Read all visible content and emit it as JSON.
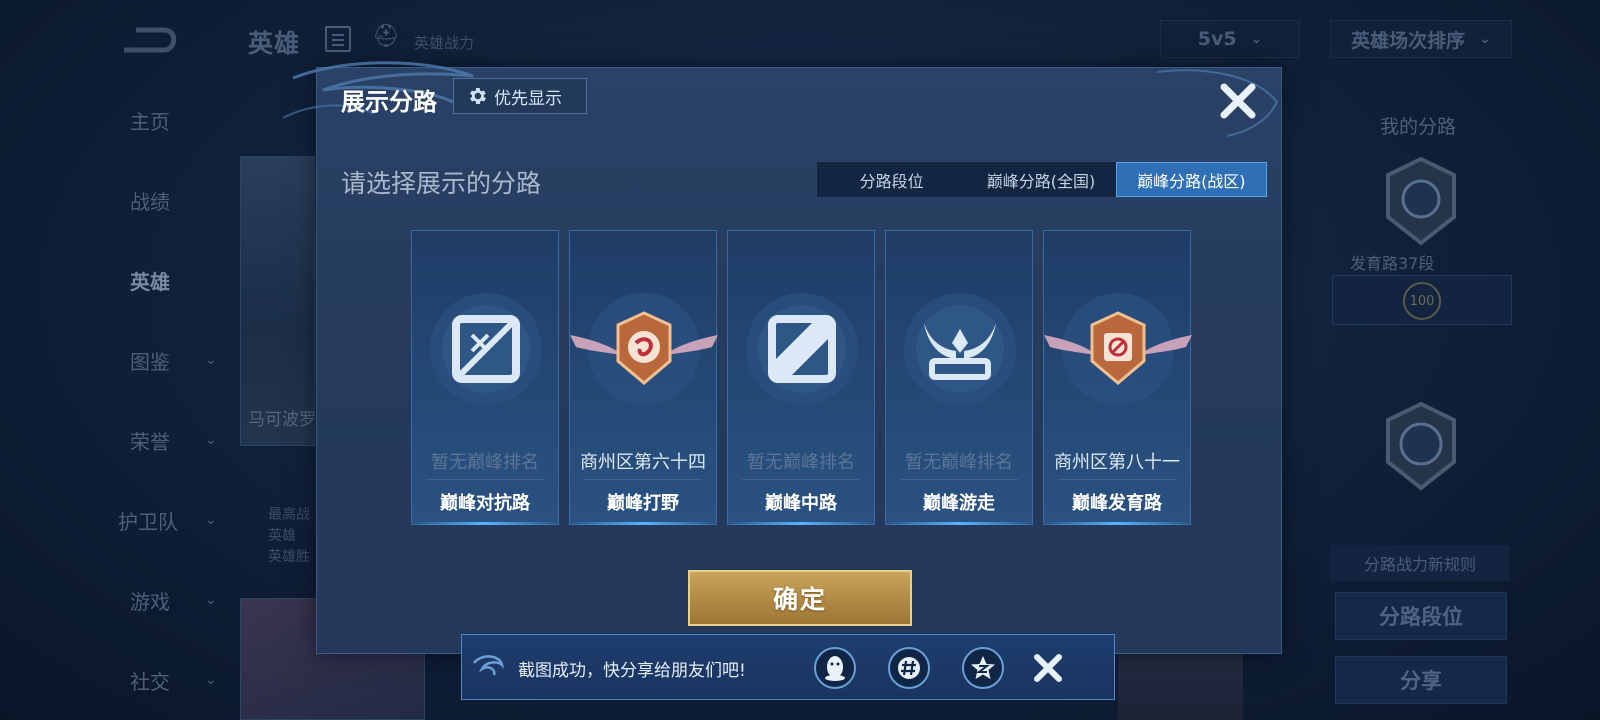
{
  "background": {
    "title": "英雄",
    "subtitle": "英雄战力",
    "mode_dropdown": "5v5",
    "sort_dropdown": "英雄场次排序",
    "sidebar": [
      {
        "label": "主页",
        "has_chevron": false
      },
      {
        "label": "战绩",
        "has_chevron": false
      },
      {
        "label": "英雄",
        "has_chevron": false,
        "active": true
      },
      {
        "label": "图鉴",
        "has_chevron": true
      },
      {
        "label": "荣誉",
        "has_chevron": true
      },
      {
        "label": "护卫队",
        "has_chevron": true
      },
      {
        "label": "游戏",
        "has_chevron": true
      },
      {
        "label": "社交",
        "has_chevron": true
      }
    ],
    "hero_name": "马可波罗",
    "hero_stats": [
      "最高战",
      "英雄",
      "英雄胜"
    ],
    "right_panel": {
      "title": "我的分路",
      "lane_rank": "发育路37段",
      "level_badge": "100",
      "rule_label": "分路战力新规则",
      "lane_tier_button": "分路段位",
      "share_button": "分享"
    }
  },
  "modal": {
    "title": "展示分路",
    "priority_button": "优先显示",
    "prompt": "请选择展示的分路",
    "tabs": [
      {
        "label": "分路段位",
        "active": false
      },
      {
        "label": "巅峰分路(全国)",
        "active": false
      },
      {
        "label": "巅峰分路(战区)",
        "active": true
      }
    ],
    "lanes": [
      {
        "name": "巅峰对抗路",
        "rank": "暂无巅峰排名",
        "ranked": false,
        "icon": "clash-lane-icon"
      },
      {
        "name": "巅峰打野",
        "rank": "商州区第六十四",
        "ranked": true,
        "icon": "jungle-medal-icon"
      },
      {
        "name": "巅峰中路",
        "rank": "暂无巅峰排名",
        "ranked": false,
        "icon": "mid-lane-icon"
      },
      {
        "name": "巅峰游走",
        "rank": "暂无巅峰排名",
        "ranked": false,
        "icon": "roam-wings-icon"
      },
      {
        "name": "巅峰发育路",
        "rank": "商州区第八十一",
        "ranked": true,
        "icon": "farm-medal-icon"
      }
    ],
    "confirm_button": "确定"
  },
  "toast": {
    "message": "截图成功，快分享给朋友们吧!",
    "share_targets": [
      "qq-icon",
      "wechat-moments-icon",
      "qzone-icon"
    ]
  },
  "colors": {
    "accent_blue": "#2f6fb6",
    "gold": "#c9a45c",
    "modal_bg": "#253a5c"
  }
}
